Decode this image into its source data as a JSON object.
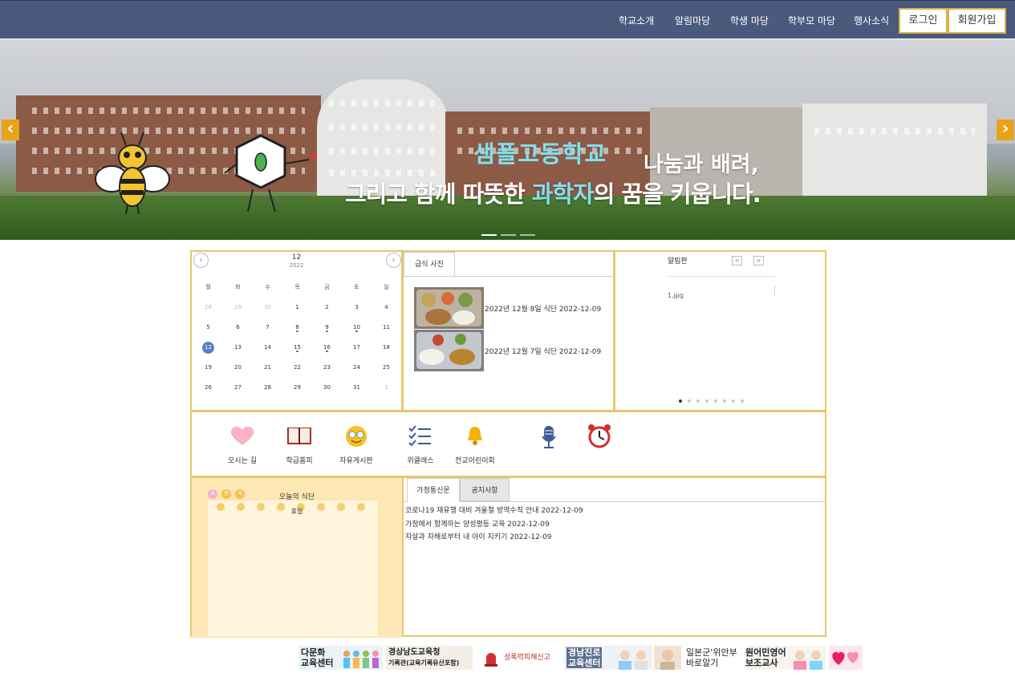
{
  "nav": {
    "links": [
      "학교소개",
      "알림마당",
      "학생 마당",
      "학부모 마당",
      "행사소식"
    ],
    "login": "로그인",
    "signup": "회원가입"
  },
  "hero": {
    "school_name": "샘플고등학교",
    "tagline_1": "나눔과 배려,",
    "tagline_2_a": "그리고 함께 따뜻한 ",
    "tagline_2_b": "과학자",
    "tagline_2_c": "의 꿈을 키웁니다.",
    "prev": "‹",
    "next": "›",
    "slide_count": 3,
    "active_slide": 1
  },
  "calendar": {
    "month": "12",
    "year": "2022",
    "prev": "‹",
    "next": "›",
    "weekdays": [
      "월",
      "화",
      "수",
      "목",
      "금",
      "토",
      "일"
    ],
    "weeks": [
      [
        {
          "d": "28",
          "dim": true
        },
        {
          "d": "29",
          "dim": true
        },
        {
          "d": "30",
          "dim": true
        },
        {
          "d": "1"
        },
        {
          "d": "2"
        },
        {
          "d": "3"
        },
        {
          "d": "4"
        }
      ],
      [
        {
          "d": "5"
        },
        {
          "d": "6"
        },
        {
          "d": "7"
        },
        {
          "d": "8",
          "ev": true
        },
        {
          "d": "9",
          "ev": true
        },
        {
          "d": "10",
          "ev": true
        },
        {
          "d": "11"
        }
      ],
      [
        {
          "d": "12",
          "today": true
        },
        {
          "d": "13"
        },
        {
          "d": "14"
        },
        {
          "d": "15",
          "ev": true
        },
        {
          "d": "16",
          "ev": true
        },
        {
          "d": "17"
        },
        {
          "d": "18"
        }
      ],
      [
        {
          "d": "19"
        },
        {
          "d": "20"
        },
        {
          "d": "21"
        },
        {
          "d": "22"
        },
        {
          "d": "23"
        },
        {
          "d": "24"
        },
        {
          "d": "25"
        }
      ],
      [
        {
          "d": "26"
        },
        {
          "d": "27"
        },
        {
          "d": "28"
        },
        {
          "d": "29"
        },
        {
          "d": "30"
        },
        {
          "d": "31"
        },
        {
          "d": "1",
          "dim": true
        }
      ]
    ]
  },
  "photos": {
    "tab": "급식 사진",
    "items": [
      {
        "caption": "2022년 12월 8일 식단 2022-12-09"
      },
      {
        "caption": "2022년 12월 7일 식단 2022-12-09"
      }
    ]
  },
  "notice_board": {
    "title": "알림판",
    "prev": "<",
    "next": ">",
    "image_alt": "1.jpg",
    "dot_count": 8,
    "active_dot": 0
  },
  "quick_links": [
    {
      "label": "오시는 길",
      "icon": "heart-icon"
    },
    {
      "label": "학급홈피",
      "icon": "book-icon"
    },
    {
      "label": "자유게시판",
      "icon": "smiley-icon"
    },
    {
      "label": "위클래스",
      "icon": "checklist-icon"
    },
    {
      "label": "전교어린이회",
      "icon": "bell-icon"
    },
    {
      "label": "",
      "icon": "microphone-icon"
    },
    {
      "label": "",
      "icon": "alarm-clock-icon"
    }
  ],
  "meal": {
    "title": "오늘의 식단",
    "body": "휴일",
    "badges": [
      "조",
      "중",
      "석"
    ]
  },
  "news": {
    "tabs": [
      "가정통신문",
      "공지사항"
    ],
    "items": [
      "코로나19 재유행 대비 겨울철 방역수칙 안내 2022-12-09",
      "가정에서 함께하는 양성평등 교육 2022-12-09",
      "자살과 자해로부터 내 아이 지키기 2022-12-09"
    ]
  },
  "banners": [
    {
      "line1": "다문화",
      "line2": "교육센터"
    },
    {
      "line1": "경상남도교육청",
      "line2": "기록관(교육기록유산포함)"
    },
    {
      "line1": "성폭력피해신고",
      "line2": ""
    },
    {
      "line1": "경남진로",
      "line2": "교육센터"
    },
    {
      "line1": "일본군'위안부'",
      "line2": "바로알기"
    },
    {
      "line1": "원어민영어",
      "line2": "보조교사"
    }
  ],
  "colors": {
    "nav_bg": "#4a5a7d",
    "accent_gold": "#e8c76a",
    "arrow_orange": "#e8a317",
    "hero_cyan": "#7fe0f0",
    "today_blue": "#5a7fc0"
  }
}
